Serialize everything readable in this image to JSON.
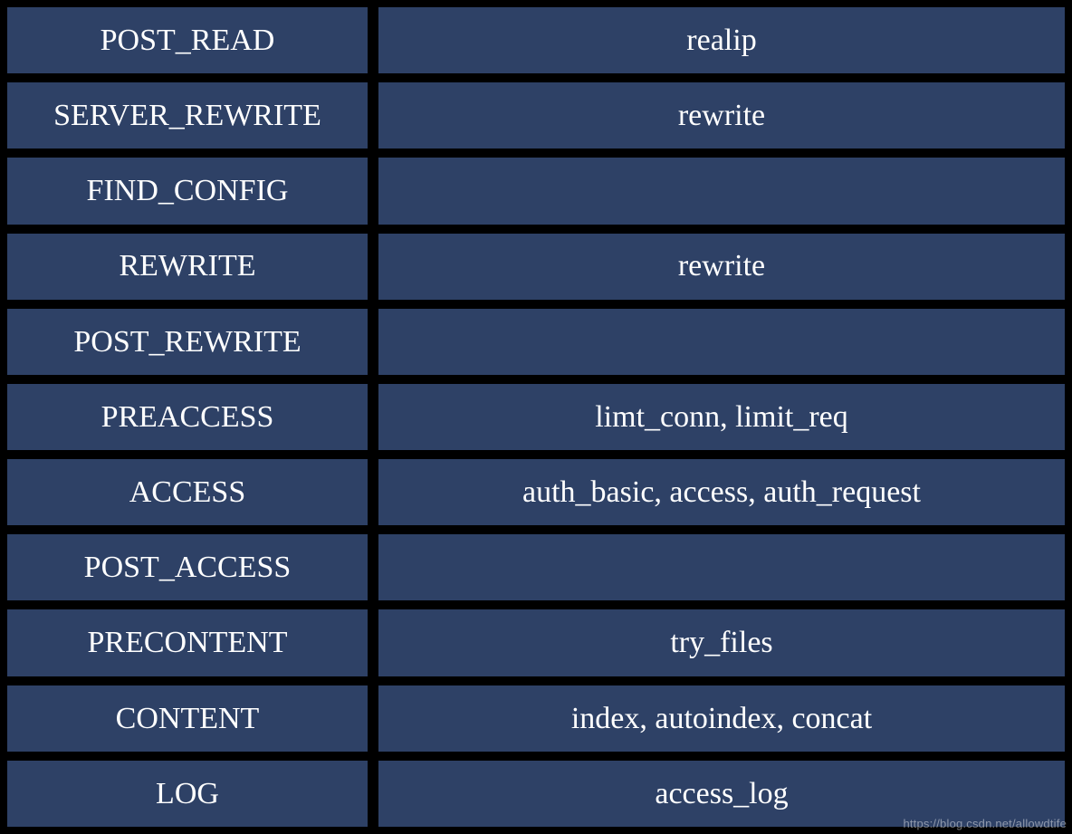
{
  "rows": [
    {
      "phase": "POST_READ",
      "modules": "realip"
    },
    {
      "phase": "SERVER_REWRITE",
      "modules": "rewrite"
    },
    {
      "phase": "FIND_CONFIG",
      "modules": ""
    },
    {
      "phase": "REWRITE",
      "modules": "rewrite"
    },
    {
      "phase": "POST_REWRITE",
      "modules": ""
    },
    {
      "phase": "PREACCESS",
      "modules": "limt_conn, limit_req"
    },
    {
      "phase": "ACCESS",
      "modules": "auth_basic, access, auth_request"
    },
    {
      "phase": "POST_ACCESS",
      "modules": ""
    },
    {
      "phase": "PRECONTENT",
      "modules": "try_files"
    },
    {
      "phase": "CONTENT",
      "modules": "index, autoindex, concat"
    },
    {
      "phase": "LOG",
      "modules": "access_log"
    }
  ],
  "watermark": "https://blog.csdn.net/allowdtife"
}
